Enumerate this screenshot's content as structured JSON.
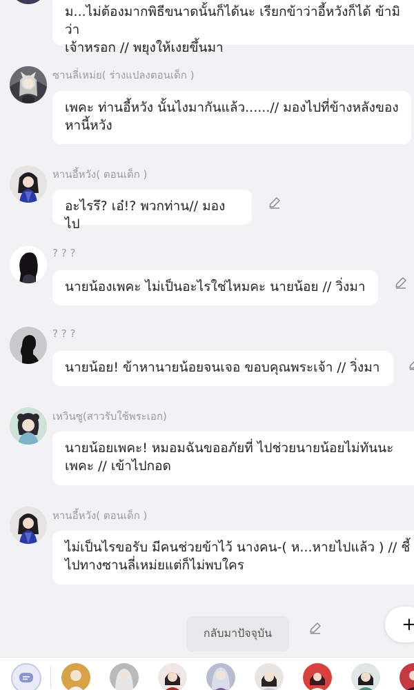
{
  "messages": [
    {
      "speaker": "",
      "text": "ม...ไม่ต้องมากพิธีขนาดนั้นก็ได้นะ เรียกข้าว่าอี้หวังก็ได้ ข้ามิว่า\nเจ้าหรอก // พยุงให้เงยขึ้นมา",
      "avatar": "partial-avatar",
      "editable": false
    },
    {
      "speaker": "ซานลี่เหม่ย( ร่างแปลงตอนเด็ก )",
      "text": "เพคะ ท่านอี้หวัง  นั้นไงมากันแล้ว......// มองไปที่ข้างหลังของ\nหานี้หวัง",
      "avatar": "white-fox-girl-avatar",
      "editable": false
    },
    {
      "speaker": "หานอี้หวัง( ตอนเด็ก )",
      "text": "อะไรรึ? เอ๋!? พวกท่าน// มองไป",
      "avatar": "boy-blue-robe-avatar",
      "editable": true
    },
    {
      "speaker": "? ? ?",
      "text": "นายน้องเพคะ ไม่เป็นอะไรใช่ไหมคะ นายน้อย // วิ่งมา",
      "avatar": "silhouette-woman-avatar",
      "editable": true
    },
    {
      "speaker": "? ? ?",
      "text": "นายน้อย! ข้าหานายน้อยจนเจอ ขอบคุณพระเจ้า // วิ่งมา",
      "avatar": "silhouette-man-avatar",
      "editable": true
    },
    {
      "speaker": "เหวินซู(สาวรับใช้พระเอก)",
      "text": "นายน้อยเพคะ! หมอมฉันขออภัยที่ ไปช่วยนายน้อยไม่ทันนะ\nเพคะ // เข้าไปกอด",
      "avatar": "maid-avatar",
      "editable": false
    },
    {
      "speaker": "หานอี้หวัง( ตอนเด็ก )",
      "text": "ไม่เป็นไรขอรับ มีคนช่วยข้าไว้ นางคน-( ห...หายไปแล้ว ) // ชี้\nไปทางซานลี่เหม่ยแต่ก็ไม่พบใคร",
      "avatar": "boy-blue-robe-avatar",
      "editable": false
    }
  ],
  "return_button": "กลับมาปัจจุบัน",
  "fab_label": "+",
  "bottom_bar": {
    "characters": [
      "character-1",
      "character-2",
      "character-3",
      "character-4",
      "character-5",
      "character-6",
      "character-7",
      "character-8"
    ]
  },
  "colors": {
    "background": "#f2f2f4",
    "bubble": "#ffffff",
    "name": "#9a9aa0",
    "accent": "#8b97cf"
  }
}
